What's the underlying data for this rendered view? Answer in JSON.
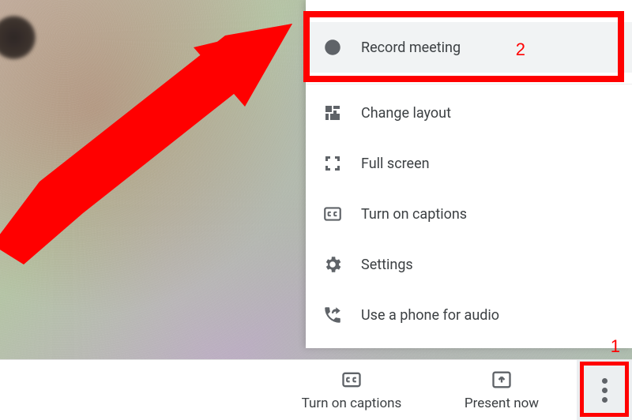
{
  "menu": {
    "record": "Record meeting",
    "layout": "Change layout",
    "fullscreen": "Full screen",
    "captions": "Turn on captions",
    "settings": "Settings",
    "phone": "Use a phone for audio"
  },
  "bottomBar": {
    "captions": "Turn on captions",
    "present": "Present now"
  },
  "annotations": {
    "step1": "1",
    "step2": "2"
  }
}
